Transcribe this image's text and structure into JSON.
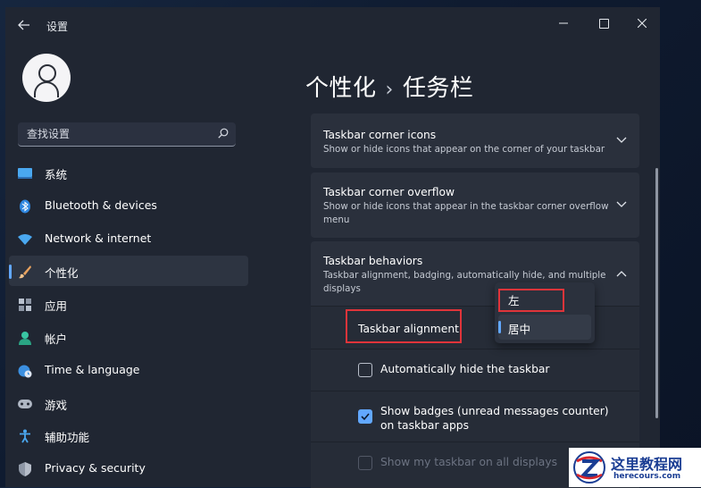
{
  "window": {
    "title": "设置",
    "back_icon": "arrow-left-icon",
    "controls": [
      "minimize-icon",
      "maximize-icon",
      "close-icon"
    ]
  },
  "search": {
    "placeholder": "查找设置",
    "icon": "search-icon"
  },
  "sidebar": {
    "items": [
      {
        "label": "系统",
        "icon": "monitor-icon",
        "active": false
      },
      {
        "label": "Bluetooth & devices",
        "icon": "bluetooth-icon",
        "active": false
      },
      {
        "label": "Network & internet",
        "icon": "wifi-icon",
        "active": false
      },
      {
        "label": "个性化",
        "icon": "brush-icon",
        "active": true
      },
      {
        "label": "应用",
        "icon": "apps-icon",
        "active": false
      },
      {
        "label": "帐户",
        "icon": "account-icon",
        "active": false
      },
      {
        "label": "Time & language",
        "icon": "globe-clock-icon",
        "active": false
      },
      {
        "label": "游戏",
        "icon": "gamepad-icon",
        "active": false
      },
      {
        "label": "辅助功能",
        "icon": "accessibility-icon",
        "active": false
      },
      {
        "label": "Privacy & security",
        "icon": "shield-icon",
        "active": false
      }
    ]
  },
  "breadcrumb": {
    "parent": "个性化",
    "separator": "›",
    "current": "任务栏"
  },
  "cards": {
    "corner_icons": {
      "title": "Taskbar corner icons",
      "desc": "Show or hide icons that appear on the corner of your taskbar",
      "expanded": false
    },
    "corner_overflow": {
      "title": "Taskbar corner overflow",
      "desc": "Show or hide icons that appear in the taskbar corner overflow menu",
      "expanded": false
    },
    "behaviors": {
      "title": "Taskbar behaviors",
      "desc": "Taskbar alignment, badging, automatically hide, and multiple displays",
      "expanded": true
    }
  },
  "behaviors": {
    "alignment_label": "Taskbar alignment",
    "alignment_options": [
      "左",
      "居中"
    ],
    "alignment_selected": "居中",
    "auto_hide": {
      "label": "Automatically hide the taskbar",
      "checked": false,
      "enabled": true
    },
    "badges": {
      "label_line1": "Show badges (unread messages counter)",
      "label_line2": "on taskbar apps",
      "checked": true,
      "enabled": true
    },
    "all_displays": {
      "label": "Show my taskbar on all displays",
      "checked": false,
      "enabled": false
    }
  },
  "watermark": {
    "text": "这里教程网",
    "url": "herecours.com"
  },
  "colors": {
    "accent": "#62a8ff",
    "window_bg": "#202632",
    "card_bg": "#2a303c",
    "highlight_box": "#e0343a"
  }
}
